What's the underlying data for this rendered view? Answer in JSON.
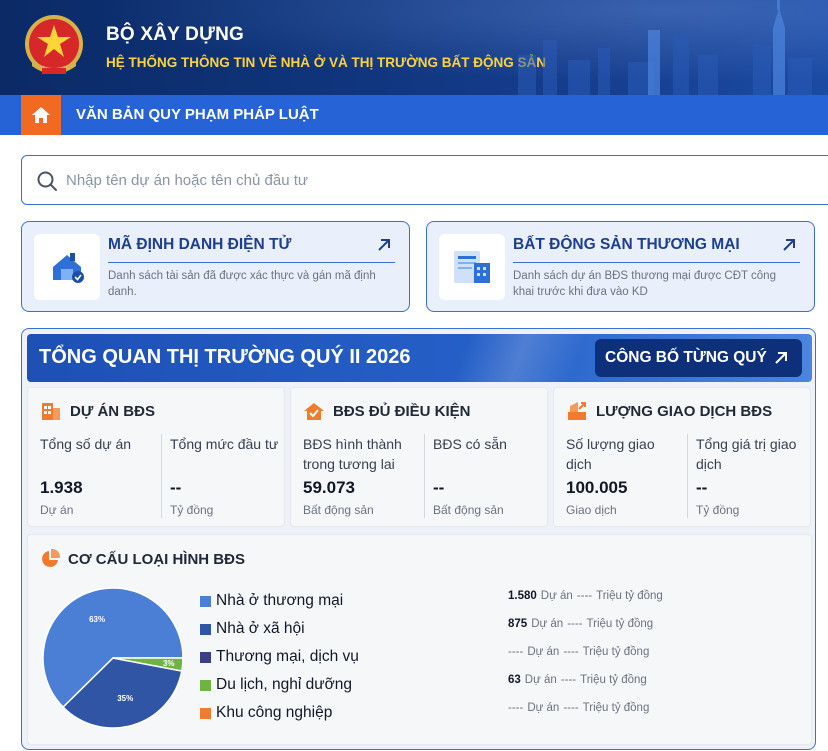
{
  "header": {
    "title": "BỘ XÂY DỰNG",
    "subtitle": "HỆ THỐNG THÔNG TIN VỀ NHÀ Ở VÀ THỊ TRƯỜNG BẤT ĐỘNG SẢN"
  },
  "nav": {
    "home_icon": "home-icon",
    "link_label": "VĂN BẢN QUY PHẠM PHÁP LUẬT"
  },
  "search": {
    "placeholder": "Nhập tên dự án hoặc tên chủ đầu tư",
    "value": ""
  },
  "cards": [
    {
      "title": "MÃ ĐỊNH DANH ĐIỆN TỬ",
      "description": "Danh sách tài sản đã được xác thực và gán mã định danh.",
      "icon": "house-id-icon"
    },
    {
      "title": "BẤT ĐỘNG SẢN THƯƠNG MẠI",
      "description": "Danh sách dự án BĐS thương mại được CĐT công khai trước khi đưa vào KD",
      "icon": "document-building-icon"
    }
  ],
  "overview": {
    "title": "TỔNG QUAN THỊ TRƯỜNG QUÝ II 2026",
    "button_label": "CÔNG BỐ TỪNG QUÝ",
    "stats": [
      {
        "title": "DỰ ÁN BĐS",
        "icon": "building-icon",
        "a": {
          "label": "Tổng số dự án",
          "value": "1.938",
          "unit": "Dự án"
        },
        "b": {
          "label": "Tổng mức đầu tư",
          "value": "--",
          "unit": "Tỷ đồng"
        }
      },
      {
        "title": "BĐS ĐỦ ĐIỀU KIỆN",
        "icon": "house-check-icon",
        "a": {
          "label": "BĐS hình thành trong tương lai",
          "value": "59.073",
          "unit": "Bất động sản"
        },
        "b": {
          "label": "BĐS có sẵn",
          "value": "--",
          "unit": "Bất động sản"
        }
      },
      {
        "title": "LƯỢNG GIAO DỊCH BĐS",
        "icon": "transaction-icon",
        "a": {
          "label": "Số lượng giao dịch",
          "value": "100.005",
          "unit": "Giao dịch"
        },
        "b": {
          "label": "Tổng giá trị giao dịch",
          "value": "--",
          "unit": "Tỷ đồng"
        }
      }
    ],
    "mix": {
      "title": "CƠ CẤU LOẠI HÌNH BĐS",
      "icon": "pie-chart-icon",
      "rows": [
        {
          "label": "Nhà ở thương mại",
          "color": "#4b7fd6",
          "count": "1.580",
          "count_unit": "Dự án",
          "value": "----",
          "value_unit": "Triệu tỷ đồng"
        },
        {
          "label": "Nhà ở xã hội",
          "color": "#2f55a4",
          "count": "875",
          "count_unit": "Dự án",
          "value": "----",
          "value_unit": "Triệu tỷ đồng"
        },
        {
          "label": "Thương mại, dịch vụ",
          "color": "#3d3f86",
          "count": "----",
          "count_unit": "Dự án",
          "value": "----",
          "value_unit": "Triệu tỷ đồng"
        },
        {
          "label": "Du lịch, nghỉ dưỡng",
          "color": "#6fb344",
          "count": "63",
          "count_unit": "Dự án",
          "value": "----",
          "value_unit": "Triệu tỷ đồng"
        },
        {
          "label": "Khu công nghiệp",
          "color": "#f07a2e",
          "count": "----",
          "count_unit": "Dự án",
          "value": "----",
          "value_unit": "Triệu tỷ đồng"
        }
      ]
    }
  },
  "chart_data": {
    "type": "pie",
    "categories": [
      "Nhà ở thương mại",
      "Nhà ở xã hội",
      "Thương mại, dịch vụ",
      "Du lịch, nghỉ dưỡng",
      "Khu công nghiệp"
    ],
    "values": [
      63,
      35,
      0,
      3,
      0
    ],
    "labels": [
      "63%",
      "35%",
      "",
      "3%",
      ""
    ],
    "colors": [
      "#4b7fd6",
      "#2f55a4",
      "#3d3f86",
      "#6fb344",
      "#f07a2e"
    ]
  }
}
